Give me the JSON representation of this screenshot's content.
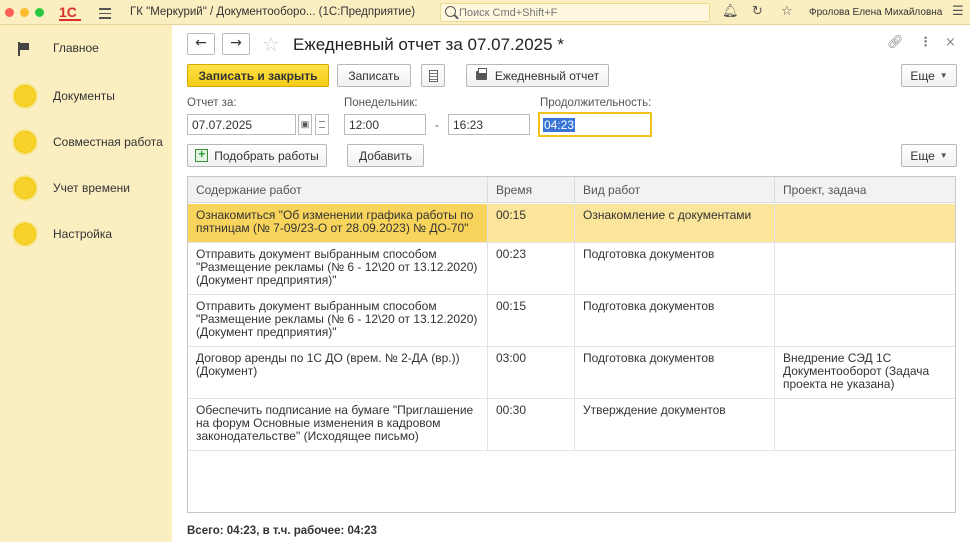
{
  "titlebar": {
    "app_title": "ГК \"Меркурий\" / Документооборо... (1С:Предприятие)",
    "logo": "1С",
    "search_placeholder": "Поиск Cmd+Shift+F",
    "user": "Фролова Елена Михайловна",
    "dot_colors": [
      "#ff5f57",
      "#febc2e",
      "#28c840"
    ]
  },
  "sidebar": {
    "items": [
      {
        "label": "Главное",
        "icon": "flag-icon"
      },
      {
        "label": "Документы",
        "icon": "circle-icon"
      },
      {
        "label": "Совместная работа",
        "icon": "circle-icon"
      },
      {
        "label": "Учет времени",
        "icon": "circle-icon"
      },
      {
        "label": "Настройка",
        "icon": "circle-icon"
      }
    ]
  },
  "header": {
    "title": "Ежедневный отчет за 07.07.2025 *"
  },
  "toolbar": {
    "save_close": "Записать и закрыть",
    "save": "Записать",
    "report": "Ежедневный отчет",
    "more": "Еще"
  },
  "form": {
    "report_for_label": "Отчет за:",
    "report_for_value": "07.07.2025",
    "weekday_label": "Понедельник:",
    "time_from": "12:00",
    "time_dash": "-",
    "time_to": "16:23",
    "duration_label": "Продолжительность:",
    "duration_value": "04:23"
  },
  "table_toolbar": {
    "pick_works": "Подобрать работы",
    "add": "Добавить",
    "more": "Еще"
  },
  "table": {
    "columns": [
      "Содержание работ",
      "Время",
      "Вид работ",
      "Проект, задача"
    ],
    "rows": [
      {
        "content": "Ознакомиться \"Об изменении графика работы по пятницам (№ 7-09/23-О от 28.09.2023) № ДО-70\"",
        "time": "00:15",
        "kind": "Ознакомление с документами",
        "project": "",
        "selected": true
      },
      {
        "content": "Отправить документ выбранным способом \"Размещение рекламы (№ 6 - 12\\20 от 13.12.2020) (Документ предприятия)\"",
        "time": "00:23",
        "kind": "Подготовка документов",
        "project": ""
      },
      {
        "content": "Отправить документ выбранным способом \"Размещение рекламы (№ 6 - 12\\20 от 13.12.2020) (Документ предприятия)\"",
        "time": "00:15",
        "kind": "Подготовка документов",
        "project": ""
      },
      {
        "content": "Договор аренды по 1С ДО (врем. № 2-ДА (вр.)) (Документ)",
        "time": "03:00",
        "kind": "Подготовка документов",
        "project": "Внедрение СЭД 1С Документооборот (Задача проекта не указана)"
      },
      {
        "content": "Обеспечить подписание на бумаге \"Приглашение на форум Основные изменения в кадровом законодательстве\" (Исходящее письмо)",
        "time": "00:30",
        "kind": "Утверждение документов",
        "project": ""
      }
    ]
  },
  "footer": {
    "total": "Всего: 04:23, в т.ч. рабочее: 04:23"
  }
}
